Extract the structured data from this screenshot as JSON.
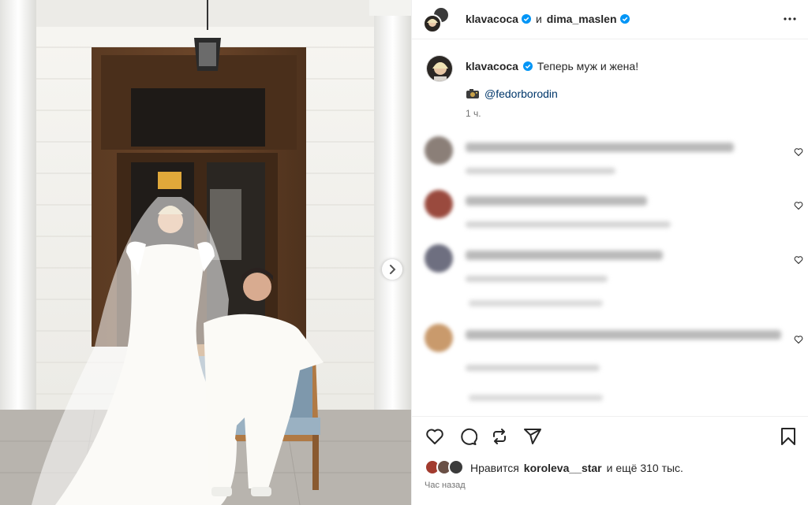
{
  "header": {
    "author": "klavacoca",
    "and_word": "и",
    "coauthor": "dima_maslen"
  },
  "caption": {
    "username": "klavacoca",
    "text": "Теперь муж и жена!",
    "camera_icon": "camera-emoji",
    "mention": "@fedorborodin",
    "time": "1 ч."
  },
  "likes": {
    "prefix": "Нравится",
    "user": "koroleva__star",
    "suffix": "и ещё 310 тыс."
  },
  "posted_ago": "Час назад",
  "icons": {
    "verified": "verified-badge-icon",
    "more": "more-options-icon",
    "like": "heart-icon",
    "comment": "comment-icon",
    "repost": "repost-icon",
    "share": "share-icon",
    "save": "bookmark-icon",
    "next": "chevron-right-icon"
  },
  "colors": {
    "verified": "#0095f6",
    "link": "#00376b",
    "muted": "#737373"
  }
}
